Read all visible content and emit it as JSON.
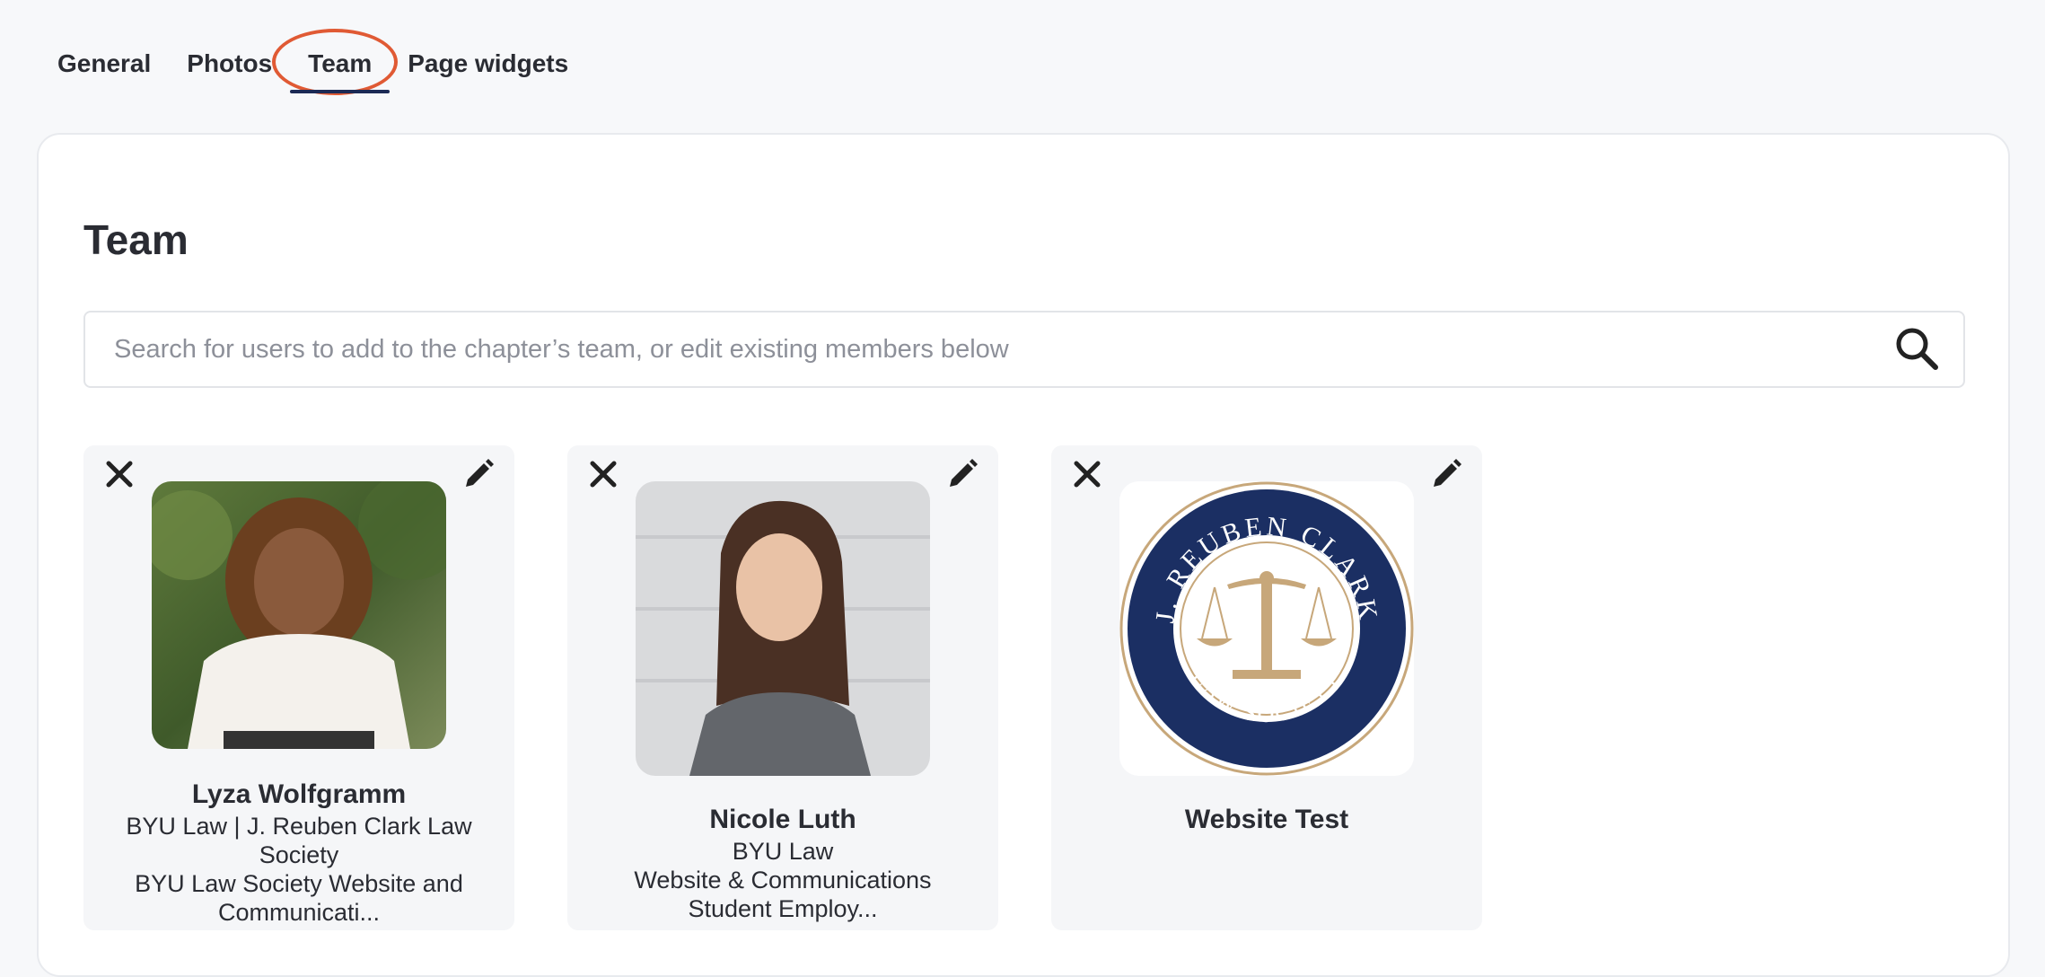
{
  "tabs": [
    {
      "label": "General"
    },
    {
      "label": "Photos"
    },
    {
      "label": "Team"
    },
    {
      "label": "Page widgets"
    }
  ],
  "active_tab": "Team",
  "panel": {
    "title": "Team"
  },
  "search": {
    "placeholder": "Search for users to add to the chapter’s team, or edit existing members below"
  },
  "members": [
    {
      "name": "Lyza Wolfgramm",
      "line1": "BYU Law | J. Reuben Clark Law Society",
      "line2": "BYU Law Society Website and Communicati..."
    },
    {
      "name": "Nicole Luth",
      "line1": "BYU Law",
      "line2": "Website & Communications Student Employ..."
    },
    {
      "name": "Website Test",
      "logo_top_text": "J. REUBEN CLARK",
      "logo_bottom_text": "LAW SOCIETY"
    }
  ],
  "colors": {
    "tab_underline": "#1c2a55",
    "highlight_ring": "#e05a34",
    "logo_navy": "#1b2f63",
    "logo_gold": "#c7a77a"
  },
  "icons": [
    "close-icon",
    "pencil-icon",
    "search-icon"
  ]
}
